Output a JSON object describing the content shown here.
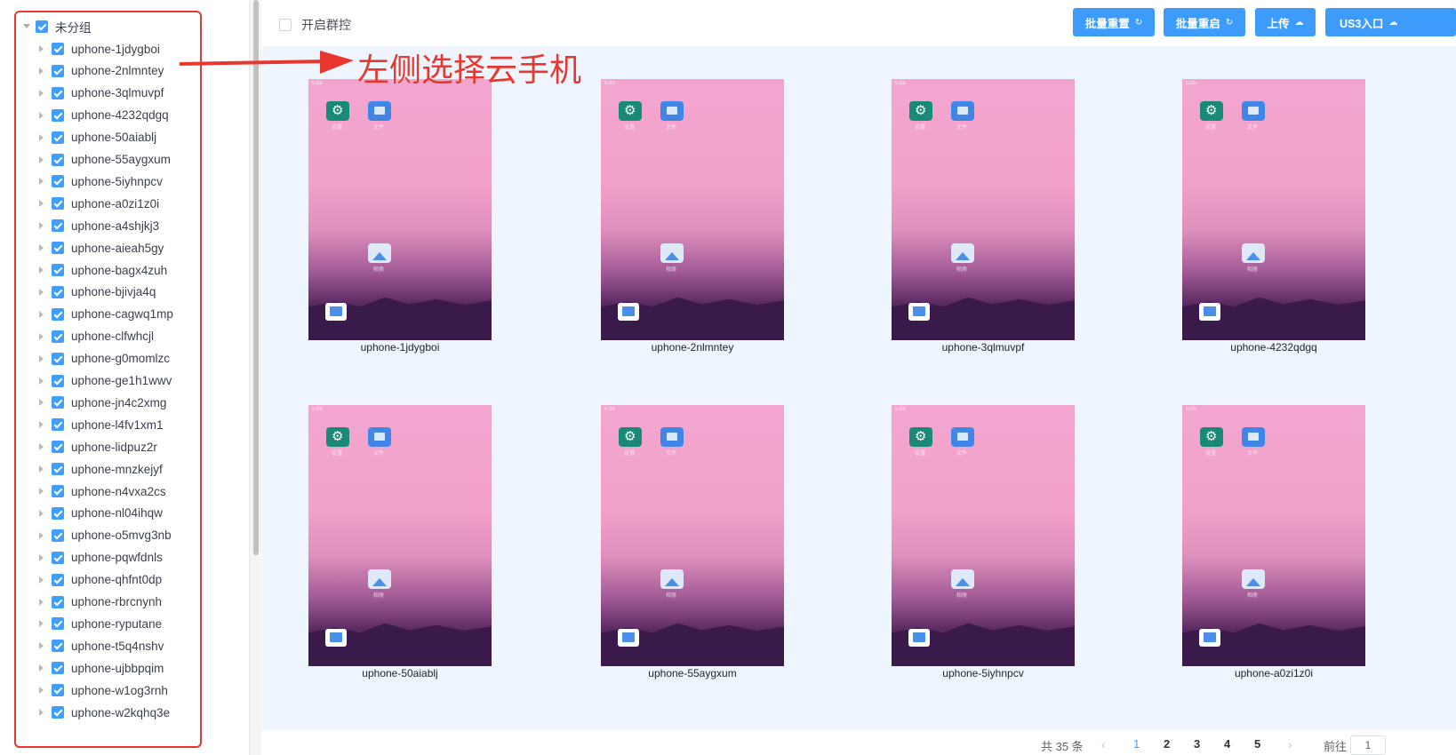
{
  "sidebar": {
    "root_label": "未分组",
    "items": [
      "uphone-1jdygboi",
      "uphone-2nlmntey",
      "uphone-3qlmuvpf",
      "uphone-4232qdgq",
      "uphone-50aiablj",
      "uphone-55aygxum",
      "uphone-5iyhnpcv",
      "uphone-a0zi1z0i",
      "uphone-a4shjkj3",
      "uphone-aieah5gy",
      "uphone-bagx4zuh",
      "uphone-bjivja4q",
      "uphone-cagwq1mp",
      "uphone-clfwhcjl",
      "uphone-g0momlzc",
      "uphone-ge1h1wwv",
      "uphone-jn4c2xmg",
      "uphone-l4fv1xm1",
      "uphone-lidpuz2r",
      "uphone-mnzkejyf",
      "uphone-n4vxa2cs",
      "uphone-nl04ihqw",
      "uphone-o5mvg3nb",
      "uphone-pqwfdnls",
      "uphone-qhfnt0dp",
      "uphone-rbrcnynh",
      "uphone-ryputane",
      "uphone-t5q4nshv",
      "uphone-ujbbpqim",
      "uphone-w1og3rnh",
      "uphone-w2kqhq3e"
    ]
  },
  "toolbar": {
    "group_control_label": "开启群控",
    "batch_reset_label": "批量重置",
    "batch_restart_label": "批量重启",
    "upload_label": "上传",
    "us3_label": "US3入口"
  },
  "annotation": {
    "text": "左侧选择云手机",
    "color": "#e8372e"
  },
  "phones": [
    "uphone-1jdygboi",
    "uphone-2nlmntey",
    "uphone-3qlmuvpf",
    "uphone-4232qdgq",
    "uphone-50aiablj",
    "uphone-55aygxum",
    "uphone-5iyhnpcv",
    "uphone-a0zi1z0i"
  ],
  "phone_screen": {
    "status_time": "5:25",
    "app_settings_label": "设置",
    "app_files_label": "文件",
    "app_gallery_label": "相册"
  },
  "pagination": {
    "total_text": "共 35 条",
    "pages": [
      "1",
      "2",
      "3",
      "4",
      "5"
    ],
    "current_page": "1",
    "goto_label": "前往",
    "goto_value": "1"
  },
  "colors": {
    "accent": "#409eff",
    "button": "#3d9bfb",
    "highlight": "#e8372e"
  }
}
